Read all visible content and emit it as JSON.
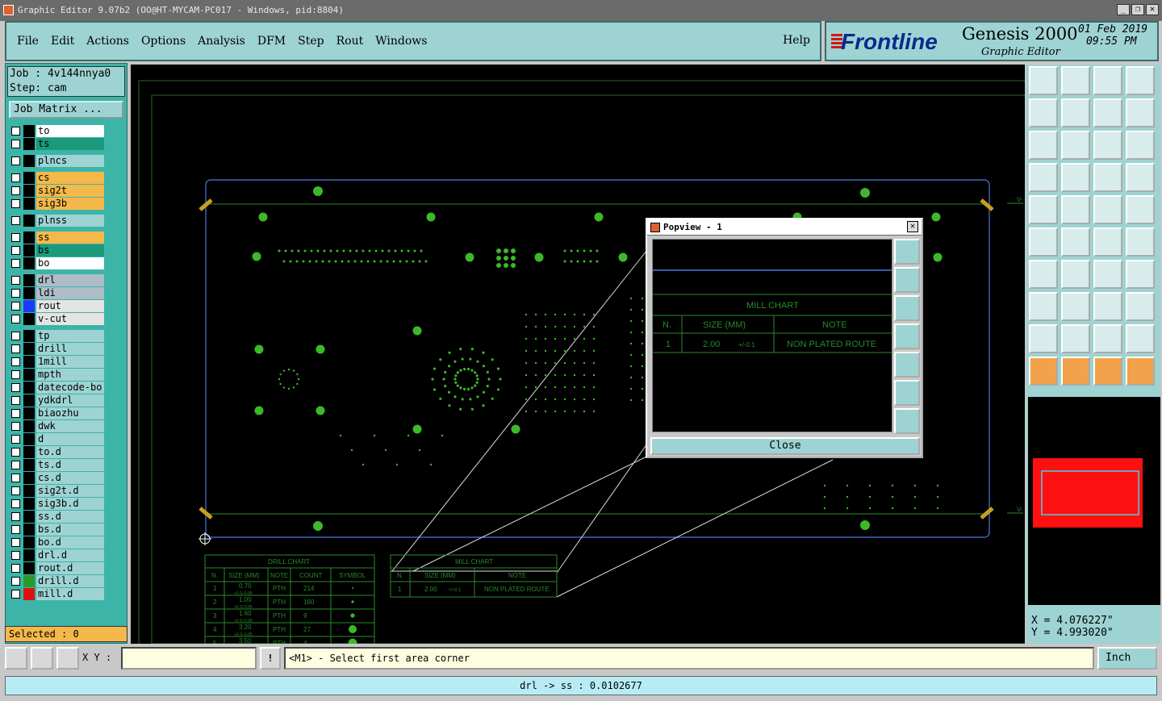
{
  "window": {
    "title": "Graphic Editor 9.07b2 (OO@HT-MYCAM-PC017 - Windows, pid:8804)",
    "controls": [
      "_",
      "❐",
      "✕"
    ]
  },
  "menu": {
    "items": [
      "File",
      "Edit",
      "Actions",
      "Options",
      "Analysis",
      "DFM",
      "Step",
      "Rout",
      "Windows"
    ],
    "help": "Help"
  },
  "brand": {
    "logo": "Frontline",
    "product": "Genesis 2000",
    "subtitle": "Graphic Editor",
    "date": "01 Feb 2019",
    "time": "09:55 PM"
  },
  "job": {
    "job_line": "Job : 4v144nnya0",
    "step_line": "Step: cam",
    "matrix_button": "Job Matrix ..."
  },
  "layers": [
    {
      "name": "to",
      "color": "#ffffff"
    },
    {
      "name": "ts",
      "color": "#1a9a7a"
    },
    {
      "name": "plncs",
      "color": "#9ed3d3"
    },
    {
      "name": "cs",
      "color": "#f5b84a"
    },
    {
      "name": "sig2t",
      "color": "#f5b84a"
    },
    {
      "name": "sig3b",
      "color": "#f5b84a"
    },
    {
      "name": "plnss",
      "color": "#9ed3d3"
    },
    {
      "name": "ss",
      "color": "#f5b84a"
    },
    {
      "name": "bs",
      "color": "#1a9a7a"
    },
    {
      "name": "bo",
      "color": "#ffffff"
    },
    {
      "name": "drl",
      "color": "#aebcc8"
    },
    {
      "name": "ldi",
      "color": "#aebcc8"
    },
    {
      "name": "rout",
      "color": "#e4e4e4",
      "swatch": "#1a3aff"
    },
    {
      "name": "v-cut",
      "color": "#e4e4e4"
    },
    {
      "name": "tp",
      "color": "#9ed3d3"
    },
    {
      "name": "drill",
      "color": "#9ed3d3"
    },
    {
      "name": "1mill",
      "color": "#9ed3d3"
    },
    {
      "name": "mpth",
      "color": "#9ed3d3"
    },
    {
      "name": "datecode-bo",
      "color": "#9ed3d3"
    },
    {
      "name": "ydkdrl",
      "color": "#9ed3d3"
    },
    {
      "name": "biaozhu",
      "color": "#9ed3d3"
    },
    {
      "name": "dwk",
      "color": "#9ed3d3"
    },
    {
      "name": "d",
      "color": "#9ed3d3"
    },
    {
      "name": "to.d",
      "color": "#9ed3d3"
    },
    {
      "name": "ts.d",
      "color": "#9ed3d3"
    },
    {
      "name": "cs.d",
      "color": "#9ed3d3"
    },
    {
      "name": "sig2t.d",
      "color": "#9ed3d3"
    },
    {
      "name": "sig3b.d",
      "color": "#9ed3d3"
    },
    {
      "name": "ss.d",
      "color": "#9ed3d3"
    },
    {
      "name": "bs.d",
      "color": "#9ed3d3"
    },
    {
      "name": "bo.d",
      "color": "#9ed3d3"
    },
    {
      "name": "drl.d",
      "color": "#9ed3d3"
    },
    {
      "name": "rout.d",
      "color": "#9ed3d3"
    },
    {
      "name": "drill.d",
      "color": "#9ed3d3",
      "swatch": "#2a9a2a"
    },
    {
      "name": "mill.d",
      "color": "#9ed3d3",
      "swatch": "#e01010"
    }
  ],
  "selected_text": "Selected : 0",
  "drill_chart": {
    "title": "DRILL CHART",
    "headers": [
      "N.",
      "SIZE (MM)",
      "NOTE",
      "COUNT",
      "SYMBOL"
    ],
    "rows": [
      {
        "n": "1",
        "size": "0.70",
        "tol": "+0.1/-0.05",
        "note": "PTH",
        "count": "214"
      },
      {
        "n": "2",
        "size": "1.00",
        "tol": "+0.1/-0.05",
        "note": "PTH",
        "count": "160"
      },
      {
        "n": "3",
        "size": "1.60",
        "tol": "+0.1/-0.05",
        "note": "PTH",
        "count": "9"
      },
      {
        "n": "4",
        "size": "3.20",
        "tol": "+0.1/-0.05",
        "note": "PTH",
        "count": "27"
      },
      {
        "n": "5",
        "size": "3.50",
        "tol": "",
        "note": "PTH",
        "count": "4"
      }
    ]
  },
  "mill_chart": {
    "title": "MILL CHART",
    "headers": [
      "N.",
      "SIZE (MM)",
      "NOTE"
    ],
    "row": {
      "n": "1",
      "size": "2.00",
      "tol": "+/-0.1",
      "note": "NON PLATED ROUTE"
    }
  },
  "vcut_label": "V-",
  "popview": {
    "title": "Popview - 1",
    "close_button": "Close"
  },
  "coords": {
    "x": "X = 4.076227\"",
    "y": "Y = 4.993020\""
  },
  "bottom": {
    "xy_label": "X Y :",
    "xy_value": "",
    "exclaim": "!",
    "prompt": "<M1> - Select first area corner",
    "unit": "Inch"
  },
  "status": "drl -> ss : 0.0102677",
  "colors": {
    "pad": "#3db82a",
    "outline": "#2a6a2a",
    "rout": "#4a7ae0",
    "panel": "#9ed3d3"
  }
}
